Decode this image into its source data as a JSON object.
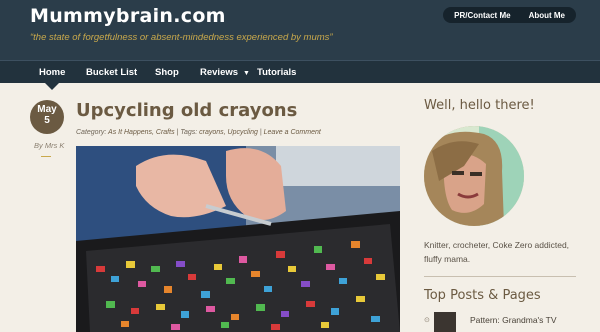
{
  "header": {
    "site_title": "Mummybrain.com",
    "tagline": "“the state of forgetfulness or absent-mindedness experienced by mums”",
    "buttons": [
      "PR/Contact Me",
      "About Me"
    ]
  },
  "nav": {
    "items": [
      "Home",
      "Bucket List",
      "Shop",
      "Reviews",
      "Tutorials"
    ],
    "caret": "▼",
    "active": "Home"
  },
  "post": {
    "date": {
      "month": "May",
      "day": "5"
    },
    "byline": "By Mrs K",
    "title": "Upcycling old crayons",
    "meta": {
      "category_label": "Category:",
      "categories": "As It Happens, Crafts",
      "separator": "|",
      "tags_label": "Tags:",
      "tags": "crayons, Upcycling",
      "comment_link": "Leave a Comment"
    },
    "image_icon": "crayon-chopping-photo"
  },
  "sidebar": {
    "greeting": "Well, hello there!",
    "avatar_icon": "profile-photo",
    "bio": "Knitter, crocheter, Coke Zero addicted, fluffy mama.",
    "top_posts_title": "Top Posts & Pages",
    "top_posts": [
      {
        "bullet": "⊙",
        "title": "Pattern: Grandma's TV"
      }
    ]
  },
  "colors": {
    "header_bg": "#2b3d4a",
    "nav_bg": "#22323d",
    "accent_brown": "#6b5a42",
    "tagline_gold": "#c9a94c",
    "page_bg": "#f3efe7"
  }
}
